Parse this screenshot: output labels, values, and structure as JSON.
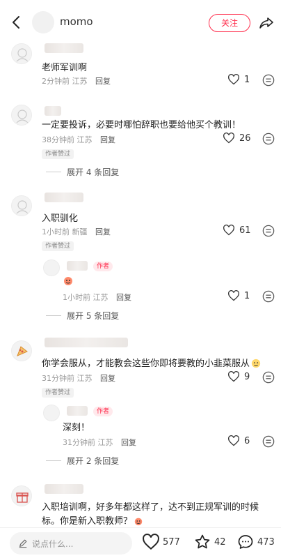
{
  "header": {
    "name": "momo",
    "follow_label": "关注"
  },
  "comments": [
    {
      "text": "老师军训啊",
      "time": "2分钟前",
      "location": "江苏",
      "reply_label": "回复",
      "likes": "1"
    },
    {
      "text": "一定要投诉，必要时哪怕辞职也要给他买个教训！",
      "time": "38分钟前",
      "location": "江苏",
      "reply_label": "回复",
      "likes": "26",
      "badge": "作者赞过",
      "expand": "展开 4 条回复"
    },
    {
      "text": "入职驯化",
      "time": "1小时前",
      "location": "新疆",
      "reply_label": "回复",
      "likes": "61",
      "badge": "作者赞过",
      "sub": {
        "author_tag": "作者",
        "time": "1小时前",
        "location": "江苏",
        "reply_label": "回复",
        "likes": "1"
      },
      "expand": "展开 5 条回复"
    },
    {
      "text": "你学会服从，才能教会这些你即将要教的小韭菜服从",
      "time": "31分钟前",
      "location": "江苏",
      "reply_label": "回复",
      "likes": "9",
      "badge": "作者赞过",
      "sub": {
        "author_tag": "作者",
        "text": "深刻！",
        "time": "31分钟前",
        "location": "江苏",
        "reply_label": "回复",
        "likes": "6"
      },
      "expand": "展开 2 条回复"
    },
    {
      "text_line1": "入职培训啊，好多年都这样了，达不到正规军训的时候",
      "text_line2": "标。你是新入职教师？"
    }
  ],
  "bottom": {
    "placeholder": "说点什么...",
    "likes": "577",
    "stars": "42",
    "comments": "473"
  }
}
